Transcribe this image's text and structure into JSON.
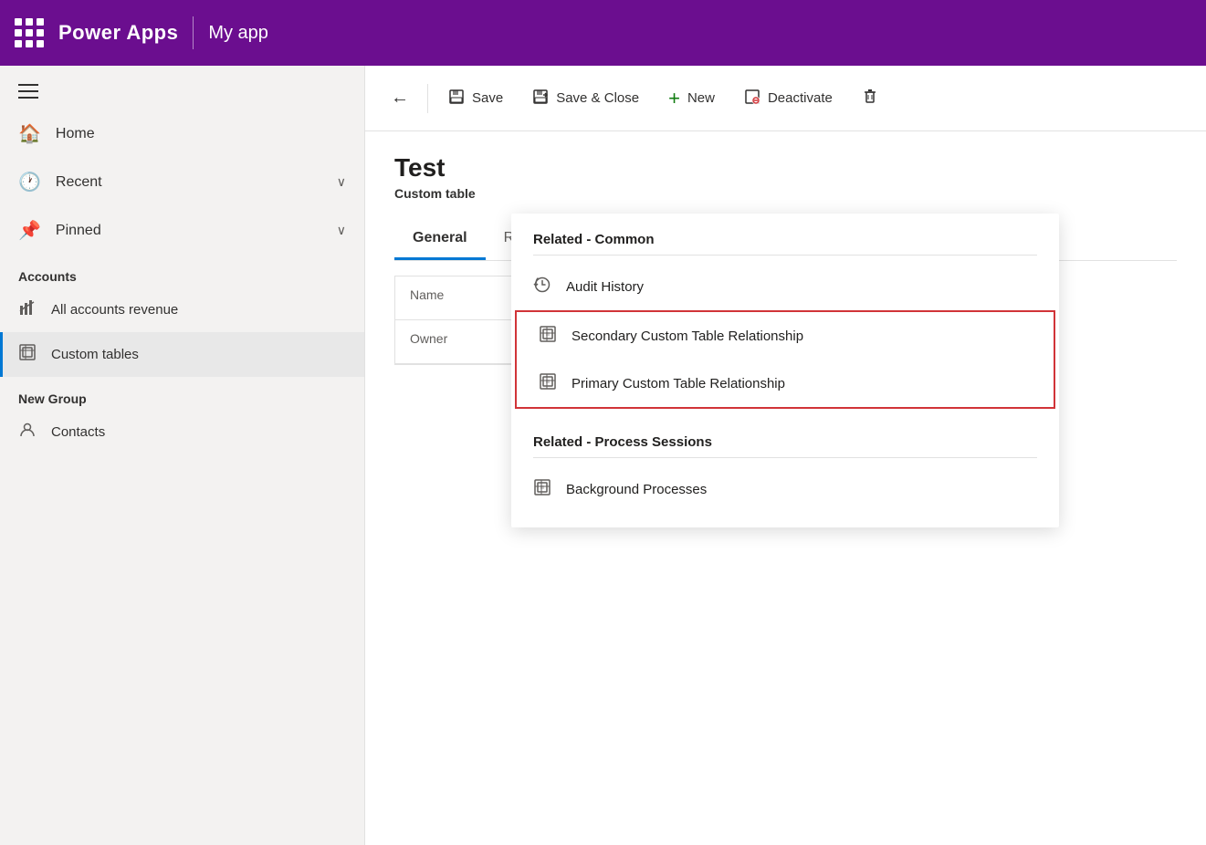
{
  "header": {
    "grid_icon": "⋮⋮⋮",
    "brand": "Power Apps",
    "divider": true,
    "app_name": "My app"
  },
  "sidebar": {
    "hamburger": "☰",
    "nav_items": [
      {
        "id": "home",
        "label": "Home",
        "icon": "🏠",
        "has_chevron": false
      },
      {
        "id": "recent",
        "label": "Recent",
        "icon": "🕐",
        "has_chevron": true
      },
      {
        "id": "pinned",
        "label": "Pinned",
        "icon": "📌",
        "has_chevron": true
      }
    ],
    "sections": [
      {
        "title": "Accounts",
        "items": [
          {
            "id": "all-accounts",
            "label": "All accounts revenue",
            "icon": "📊",
            "active": false
          },
          {
            "id": "custom-tables",
            "label": "Custom tables",
            "icon": "🗃",
            "active": true
          }
        ]
      },
      {
        "title": "New Group",
        "items": [
          {
            "id": "contacts",
            "label": "Contacts",
            "icon": "👤",
            "active": false
          }
        ]
      }
    ]
  },
  "toolbar": {
    "back_label": "←",
    "save_label": "Save",
    "save_close_label": "Save & Close",
    "new_label": "New",
    "deactivate_label": "Deactivate",
    "delete_label": "🗑"
  },
  "record": {
    "title": "Test",
    "subtitle": "Custom table"
  },
  "tabs": [
    {
      "id": "general",
      "label": "General",
      "active": true
    },
    {
      "id": "related",
      "label": "Related",
      "active": false
    }
  ],
  "form": {
    "name_label": "Name",
    "owner_label": "Owner"
  },
  "dropdown": {
    "visible": true,
    "sections": [
      {
        "title": "Related - Common",
        "items": [
          {
            "id": "audit-history",
            "label": "Audit History",
            "icon": "history",
            "highlighted": false
          },
          {
            "id": "secondary-custom",
            "label": "Secondary Custom Table Relationship",
            "icon": "table",
            "highlighted": true
          },
          {
            "id": "primary-custom",
            "label": "Primary Custom Table Relationship",
            "icon": "table",
            "highlighted": true
          }
        ]
      },
      {
        "title": "Related - Process Sessions",
        "items": [
          {
            "id": "background-processes",
            "label": "Background Processes",
            "icon": "table",
            "highlighted": false
          }
        ]
      }
    ]
  }
}
